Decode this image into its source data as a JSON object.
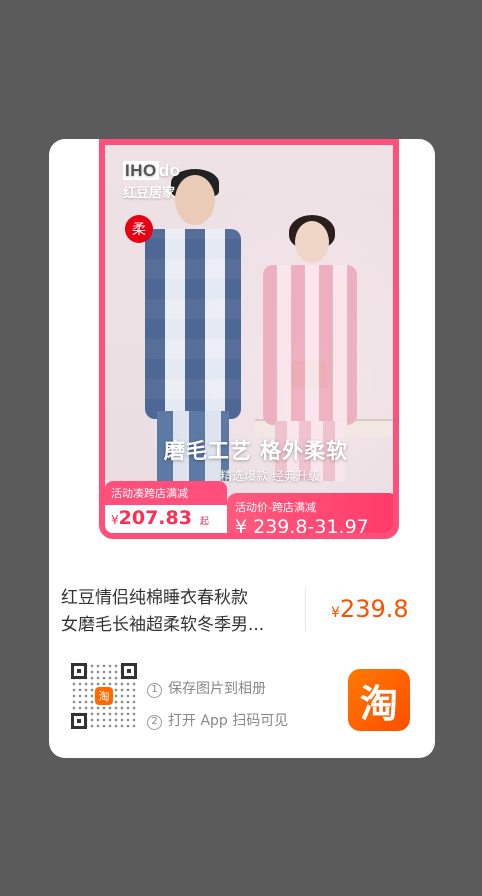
{
  "brand": {
    "logo_prefix": "IHO",
    "logo_suffix": "do",
    "name": "红豆居家"
  },
  "badge": "柔",
  "headline": "磨毛工艺 格外柔软",
  "subline": "精选爆款 经典升级",
  "promo_left": {
    "label": "活动凑跨店满减",
    "currency": "¥",
    "amount": "207.83",
    "suffix": "起"
  },
  "promo_right": {
    "label": "活动价-跨店满减",
    "price": "¥ 239.8-31.97"
  },
  "product": {
    "title_line1": "红豆情侣纯棉睡衣春秋款",
    "title_line2": "女磨毛长袖超柔软冬季男...",
    "currency": "¥",
    "price": "239.8"
  },
  "qr": {
    "center_icon_text": "淘"
  },
  "steps": [
    {
      "num": "1",
      "text": "保存图片到相册"
    },
    {
      "num": "2",
      "text": "打开 App 扫码可见"
    }
  ],
  "taobao_icon_text": "淘",
  "colors": {
    "accent": "#ff4f7a",
    "price": "#ff5000",
    "taobao": "#ff5a00"
  }
}
